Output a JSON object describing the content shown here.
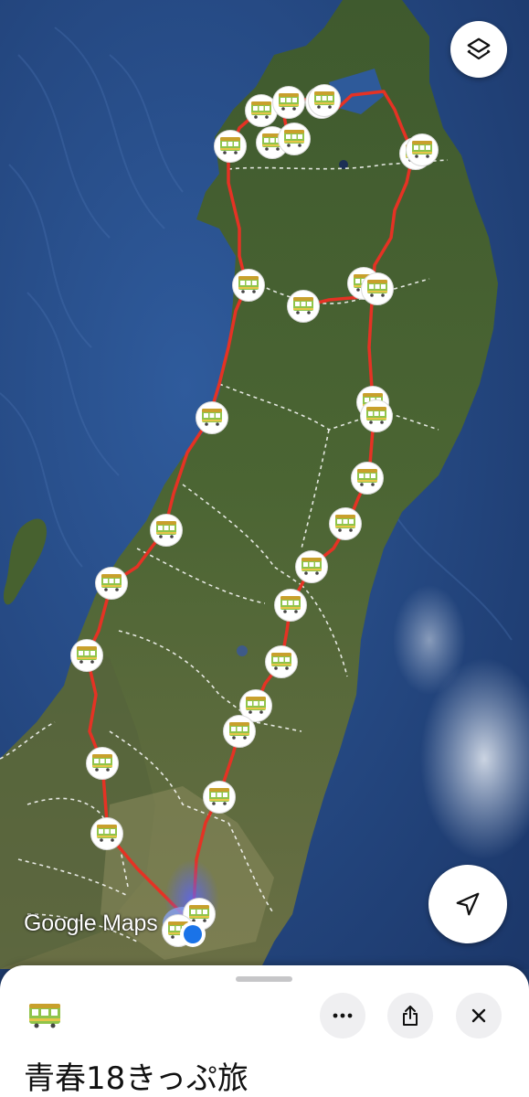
{
  "map": {
    "watermark": "Google Maps",
    "route_color": "#e53224",
    "marker_icon": "tram-car-emoji",
    "current_location_color": "#1a73e8",
    "stops": [
      {
        "name": "stop-1"
      },
      {
        "name": "stop-2"
      },
      {
        "name": "stop-3"
      },
      {
        "name": "stop-4"
      },
      {
        "name": "stop-5"
      },
      {
        "name": "stop-6"
      },
      {
        "name": "stop-7"
      },
      {
        "name": "stop-8"
      },
      {
        "name": "stop-9"
      },
      {
        "name": "stop-10"
      },
      {
        "name": "stop-11"
      },
      {
        "name": "stop-12"
      },
      {
        "name": "stop-13"
      },
      {
        "name": "stop-14"
      },
      {
        "name": "stop-15"
      },
      {
        "name": "stop-16"
      },
      {
        "name": "stop-17"
      },
      {
        "name": "stop-18"
      },
      {
        "name": "stop-19"
      },
      {
        "name": "stop-20"
      },
      {
        "name": "stop-21"
      },
      {
        "name": "stop-22"
      },
      {
        "name": "stop-23"
      },
      {
        "name": "stop-24"
      },
      {
        "name": "stop-25"
      },
      {
        "name": "stop-26"
      },
      {
        "name": "stop-27"
      },
      {
        "name": "stop-28"
      },
      {
        "name": "stop-29"
      },
      {
        "name": "stop-30"
      },
      {
        "name": "stop-31"
      }
    ]
  },
  "controls": {
    "layers_icon": "layers-icon",
    "locate_icon": "navigation-arrow-icon"
  },
  "sheet": {
    "emoji": "tram-car-emoji",
    "title": "青春18きっぷ旅",
    "more_icon": "more-horizontal-icon",
    "share_icon": "share-icon",
    "close_icon": "close-icon"
  }
}
